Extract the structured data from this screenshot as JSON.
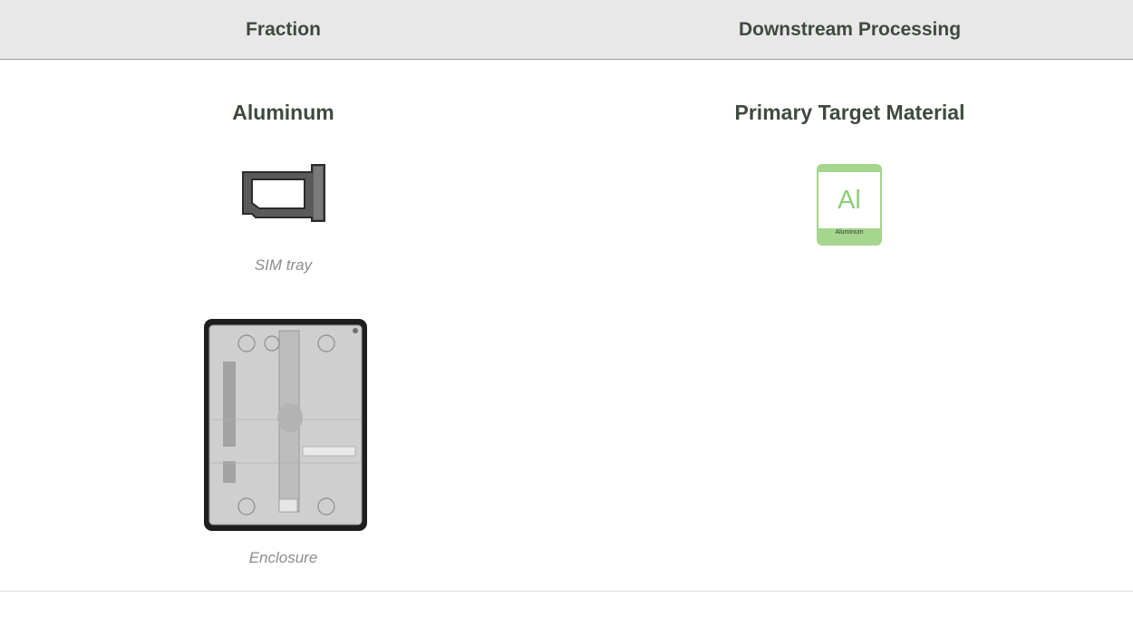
{
  "header": {
    "col1": "Fraction",
    "col2": "Downstream Processing"
  },
  "fraction": {
    "title": "Aluminum",
    "items": [
      {
        "caption": "SIM tray",
        "icon": "sim-tray-icon"
      },
      {
        "caption": "Enclosure",
        "icon": "enclosure-icon"
      }
    ]
  },
  "processing": {
    "title": "Primary Target Material",
    "material": {
      "symbol": "Al",
      "name": "Aluminum",
      "color": "#a6d58e"
    }
  },
  "colors": {
    "header_bg": "#e8e8e8",
    "heading_text": "#3e4a3e",
    "caption_text": "#8c8c8c",
    "material_green": "#a6d58e"
  }
}
